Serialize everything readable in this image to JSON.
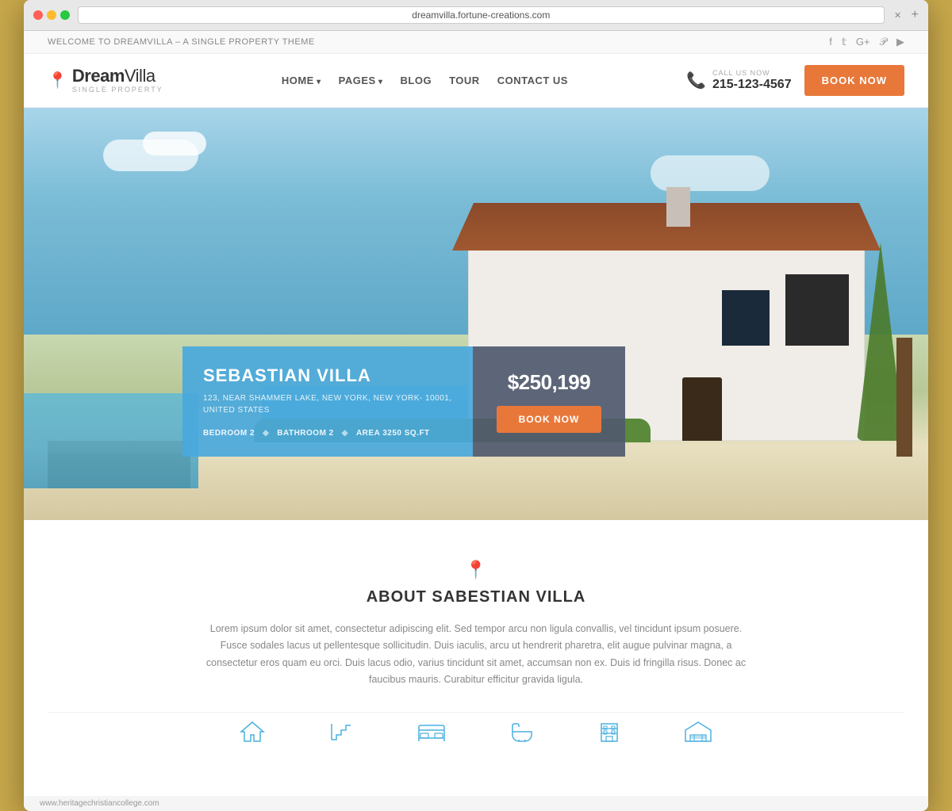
{
  "browser": {
    "url": "dreamvilla.fortune-creations.com",
    "close_symbol": "✕",
    "add_symbol": "+"
  },
  "topbar": {
    "welcome_text": "WELCOME TO DREAMVILLA – A SINGLE PROPERTY THEME",
    "social_icons": [
      "f",
      "𝕋",
      "G+",
      "𝙋",
      "▶"
    ]
  },
  "logo": {
    "icon": "📍",
    "name_bold": "Dream",
    "name_light": "Villa",
    "tagline": "SINGLE PROPERTY"
  },
  "nav": {
    "items": [
      {
        "label": "HOME",
        "has_dropdown": true
      },
      {
        "label": "PAGES",
        "has_dropdown": true
      },
      {
        "label": "BLOG",
        "has_dropdown": false
      },
      {
        "label": "TOUR",
        "has_dropdown": false
      },
      {
        "label": "CONTACT US",
        "has_dropdown": false
      }
    ]
  },
  "phone": {
    "label": "CALL US NOW",
    "number": "215-123-4567",
    "icon": "📞"
  },
  "book_now_nav": "BOOK NOW",
  "hero": {
    "property_name": "SEBASTIAN VILLA",
    "address_line1": "123, NEAR SHAMMER LAKE, NEW YORK, NEW YORK- 10001,",
    "address_line2": "UNITED STATES",
    "bedroom": "BEDROOM  2",
    "bathroom": "BATHROOM  2",
    "area": "AREA  3250 SQ.FT",
    "price": "$250,199",
    "book_now_label": "BOOK NOW"
  },
  "about": {
    "pin_icon": "📍",
    "title": "ABOUT SABESTIAN VILLA",
    "text": "Lorem ipsum dolor sit amet, consectetur adipiscing elit. Sed tempor arcu non ligula convallis, vel tincidunt ipsum posuere. Fusce sodales lacus ut pellentesque sollicitudin. Duis iaculis, arcu ut hendrerit pharetra, elit augue pulvinar magna, a consectetur eros quam eu orci. Duis lacus odio, varius tincidunt sit amet, accumsan non ex. Duis id fringilla risus. Donec ac faucibus mauris. Curabitur efficitur gravida ligula."
  },
  "feature_icons": [
    {
      "name": "house-icon",
      "symbol": "⌂"
    },
    {
      "name": "stairs-icon",
      "symbol": "⇱"
    },
    {
      "name": "bed-icon",
      "symbol": "🛏"
    },
    {
      "name": "bath-icon",
      "symbol": "🛁"
    },
    {
      "name": "building-icon",
      "symbol": "🏢"
    },
    {
      "name": "garage-icon",
      "symbol": "⌂"
    }
  ],
  "statusbar": {
    "url": "www.heritagechristiancollege.com"
  }
}
